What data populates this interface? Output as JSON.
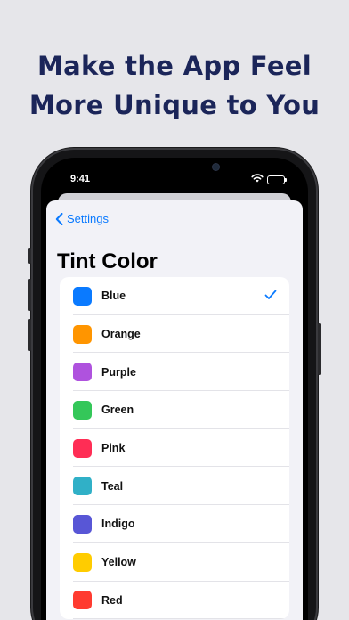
{
  "headline": {
    "line1": "Make the App Feel",
    "line2": "More Unique to You"
  },
  "status_bar": {
    "time": "9:41",
    "icons": [
      "wifi-icon",
      "battery-icon"
    ]
  },
  "nav": {
    "back_label": "Settings",
    "back_icon": "chevron-left-icon"
  },
  "page": {
    "title": "Tint Color"
  },
  "colors": {
    "accent": "#0a7aff"
  },
  "tints": [
    {
      "label": "Blue",
      "color": "#0a7aff",
      "selected": true
    },
    {
      "label": "Orange",
      "color": "#ff9500",
      "selected": false
    },
    {
      "label": "Purple",
      "color": "#af52de",
      "selected": false
    },
    {
      "label": "Green",
      "color": "#34c759",
      "selected": false
    },
    {
      "label": "Pink",
      "color": "#ff2d55",
      "selected": false
    },
    {
      "label": "Teal",
      "color": "#30b0c7",
      "selected": false
    },
    {
      "label": "Indigo",
      "color": "#5856d6",
      "selected": false
    },
    {
      "label": "Yellow",
      "color": "#ffcc00",
      "selected": false
    },
    {
      "label": "Red",
      "color": "#ff3b30",
      "selected": false
    }
  ]
}
